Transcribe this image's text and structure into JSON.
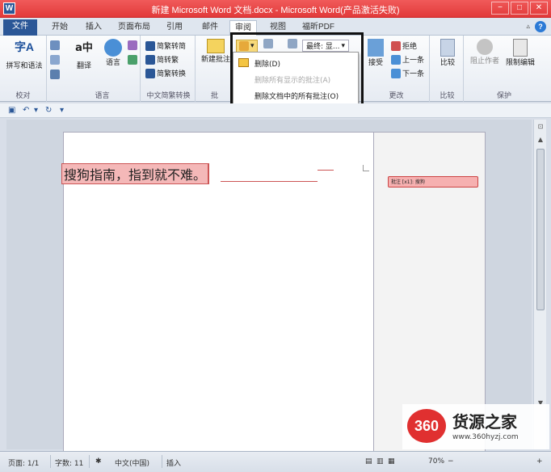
{
  "window": {
    "title": "新建 Microsoft Word 文档.docx - Microsoft Word(产品激活失败)",
    "app_icon": "W",
    "minimize": "−",
    "maximize": "□",
    "close": "✕",
    "help": "?"
  },
  "tabs": [
    {
      "label": "文件"
    },
    {
      "label": "开始"
    },
    {
      "label": "插入"
    },
    {
      "label": "页面布局"
    },
    {
      "label": "引用"
    },
    {
      "label": "邮件"
    },
    {
      "label": "审阅"
    },
    {
      "label": "视图"
    },
    {
      "label": "福昕PDF"
    }
  ],
  "ribbon": {
    "proofing": {
      "spell": "拼写和语法",
      "group": "校对"
    },
    "language": {
      "translate": "翻译",
      "language": "语言",
      "group": "语言"
    },
    "chinese": {
      "to_trad": "简繁转简",
      "to_simp": "简转繁",
      "convert": "简繁转换",
      "group": "中文简繁转换"
    },
    "comments": {
      "new": "新建批注",
      "group": "批"
    },
    "tracking": {
      "display": "最终: 显..."
    },
    "changes": {
      "accept": "接受",
      "reject": "拒绝",
      "prev": "上一条",
      "next": "下一条",
      "group": "更改"
    },
    "compare": {
      "compare": "比较",
      "group": "比较"
    },
    "protect": {
      "block": "阻止作者",
      "restrict": "限制编辑",
      "group": "保护"
    }
  },
  "dropdown": {
    "items": [
      {
        "label": "删除(D)",
        "enabled": true
      },
      {
        "label": "删除所有显示的批注(A)",
        "enabled": false
      },
      {
        "label": "删除文档中的所有批注(O)",
        "enabled": true
      }
    ]
  },
  "document": {
    "body_text": "搜狗指南，指到就不难。",
    "comment": "批注 [x1]: 搜狗"
  },
  "status": {
    "page": "页面: 1/1",
    "words": "字数: 11",
    "lang": "中文(中国)",
    "mode": "插入",
    "zoom": "70%"
  },
  "watermark": {
    "logo": "360",
    "name": "货源之家",
    "url": "www.360hyzj.com"
  },
  "colors": {
    "titlebar": "#e23a3a",
    "file_tab": "#2b5797",
    "comment_bg": "#f6b0b0"
  }
}
